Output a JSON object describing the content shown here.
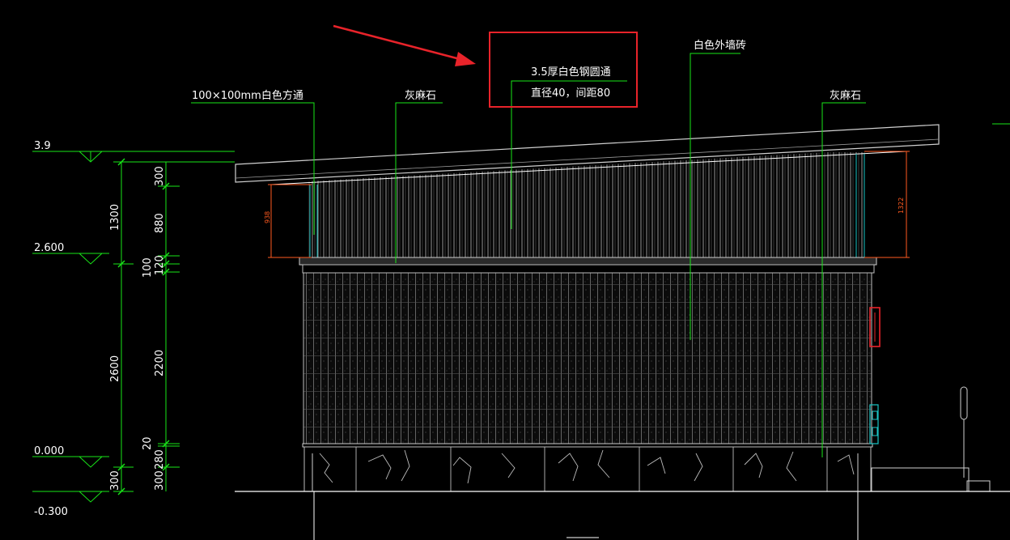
{
  "annotations": {
    "square_tube": "100×100mm白色方通",
    "stone_left": "灰麻石",
    "steel_tube_line1": "3.5厚白色钢圆通",
    "steel_tube_line2": "直径40，间距80",
    "wall_tile": "白色外墙砖",
    "stone_right": "灰麻石"
  },
  "elevations": {
    "e1": "3.9",
    "e2": "2.600",
    "e3": "0.000",
    "e4": "-0.300"
  },
  "dims_outer": {
    "d1": "1300",
    "d2": "2600",
    "d3": "300"
  },
  "dims_inner": {
    "d1": "300",
    "d2": "880",
    "d3": "120",
    "d4": "100",
    "d5": "2200",
    "d6": "20",
    "d7": "280",
    "d8": "300"
  },
  "red_dims": {
    "left": "938",
    "right": "1322"
  },
  "colors": {
    "background": "#000000",
    "line_green": "#19e619",
    "text": "#ffffff",
    "highlight_red": "#e8232a",
    "dim_red": "#ff5a1f"
  }
}
